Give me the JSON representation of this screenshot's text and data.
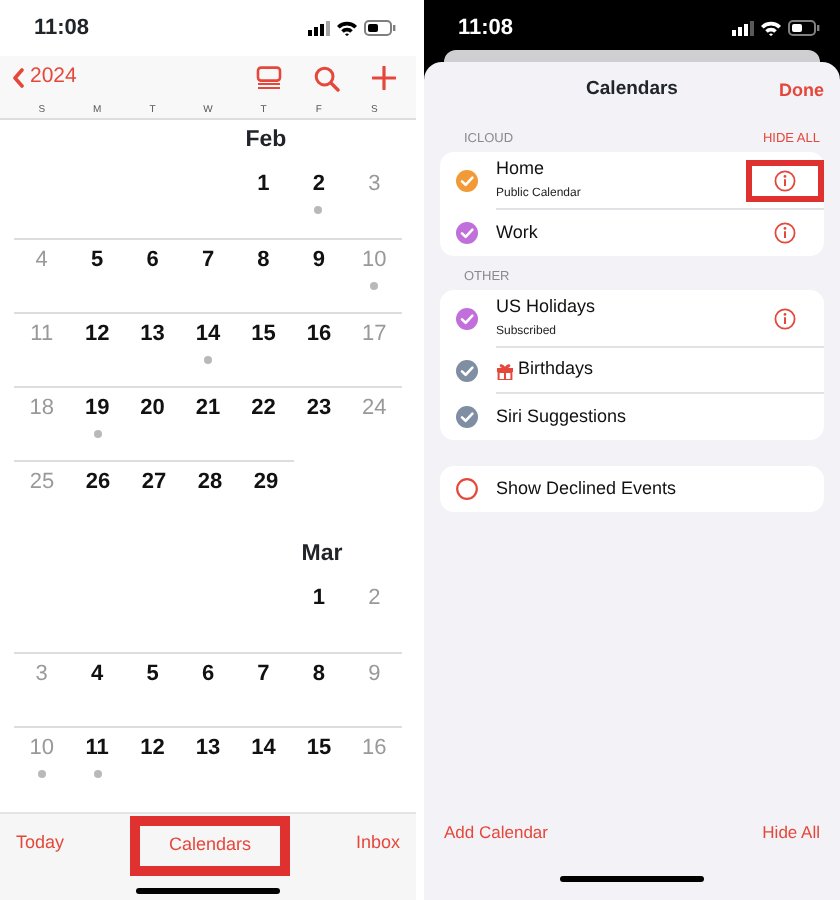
{
  "calendar_view": {
    "status_bar": {
      "time": "11:08"
    },
    "nav_bar": {
      "back_label": "2024"
    },
    "weekdays": [
      "S",
      "M",
      "T",
      "W",
      "T",
      "F",
      "S"
    ],
    "months": [
      {
        "name": "Feb",
        "weeks": [
          {
            "kind": "leading",
            "days": [
              {
                "day": "1",
                "dimmed": false,
                "event": false
              },
              {
                "day": "2",
                "dimmed": false,
                "event": true
              },
              {
                "day": "3",
                "dimmed": true,
                "event": false
              }
            ]
          },
          {
            "kind": "full",
            "days": [
              {
                "day": "4",
                "dimmed": true,
                "event": false
              },
              {
                "day": "5",
                "dimmed": false,
                "event": false
              },
              {
                "day": "6",
                "dimmed": false,
                "event": false
              },
              {
                "day": "7",
                "dimmed": false,
                "event": false
              },
              {
                "day": "8",
                "dimmed": false,
                "event": false
              },
              {
                "day": "9",
                "dimmed": false,
                "event": false
              },
              {
                "day": "10",
                "dimmed": true,
                "event": true
              }
            ]
          },
          {
            "kind": "full",
            "days": [
              {
                "day": "11",
                "dimmed": true,
                "event": false
              },
              {
                "day": "12",
                "dimmed": false,
                "event": false
              },
              {
                "day": "13",
                "dimmed": false,
                "event": false
              },
              {
                "day": "14",
                "dimmed": false,
                "event": true
              },
              {
                "day": "15",
                "dimmed": false,
                "event": false
              },
              {
                "day": "16",
                "dimmed": false,
                "event": false
              },
              {
                "day": "17",
                "dimmed": true,
                "event": false
              }
            ]
          },
          {
            "kind": "full",
            "days": [
              {
                "day": "18",
                "dimmed": true,
                "event": false
              },
              {
                "day": "19",
                "dimmed": false,
                "event": true
              },
              {
                "day": "20",
                "dimmed": false,
                "event": false
              },
              {
                "day": "21",
                "dimmed": false,
                "event": false
              },
              {
                "day": "22",
                "dimmed": false,
                "event": false
              },
              {
                "day": "23",
                "dimmed": false,
                "event": false
              },
              {
                "day": "24",
                "dimmed": true,
                "event": false
              }
            ]
          },
          {
            "kind": "trailing",
            "days": [
              {
                "day": "25",
                "dimmed": true,
                "event": false
              },
              {
                "day": "26",
                "dimmed": false,
                "event": false
              },
              {
                "day": "27",
                "dimmed": false,
                "event": false
              },
              {
                "day": "28",
                "dimmed": false,
                "event": false
              },
              {
                "day": "29",
                "dimmed": false,
                "event": false
              }
            ]
          }
        ]
      },
      {
        "name": "Mar",
        "weeks": [
          {
            "kind": "leading",
            "days": [
              {
                "day": "1",
                "dimmed": false,
                "event": false
              },
              {
                "day": "2",
                "dimmed": true,
                "event": false
              }
            ]
          },
          {
            "kind": "full",
            "days": [
              {
                "day": "3",
                "dimmed": true,
                "event": false
              },
              {
                "day": "4",
                "dimmed": false,
                "event": false
              },
              {
                "day": "5",
                "dimmed": false,
                "event": false
              },
              {
                "day": "6",
                "dimmed": false,
                "event": false
              },
              {
                "day": "7",
                "dimmed": false,
                "event": false
              },
              {
                "day": "8",
                "dimmed": false,
                "event": false
              },
              {
                "day": "9",
                "dimmed": true,
                "event": false
              }
            ]
          },
          {
            "kind": "full",
            "days": [
              {
                "day": "10",
                "dimmed": true,
                "event": true
              },
              {
                "day": "11",
                "dimmed": false,
                "event": true
              },
              {
                "day": "12",
                "dimmed": false,
                "event": false
              },
              {
                "day": "13",
                "dimmed": false,
                "event": false
              },
              {
                "day": "14",
                "dimmed": false,
                "event": false
              },
              {
                "day": "15",
                "dimmed": false,
                "event": false
              },
              {
                "day": "16",
                "dimmed": true,
                "event": false
              }
            ]
          }
        ]
      }
    ],
    "toolbar": [
      {
        "label": "Today",
        "highlighted": false
      },
      {
        "label": "Calendars",
        "highlighted": true
      },
      {
        "label": "Inbox",
        "highlighted": false
      }
    ]
  },
  "calendars_sheet": {
    "status_bar": {
      "time": "11:08"
    },
    "title": "Calendars",
    "done": "Done",
    "sections": [
      {
        "label": "ICLOUD",
        "action": "HIDE ALL",
        "calendars": [
          {
            "name": "Home",
            "subtitle": "Public Calendar",
            "checked": true,
            "color": "#f19a37",
            "gift": false,
            "info": true,
            "highlighted": true
          },
          {
            "name": "Work",
            "checked": true,
            "color": "#c16fdb",
            "gift": false,
            "info": true,
            "highlighted": false
          }
        ]
      },
      {
        "label": "OTHER",
        "calendars": [
          {
            "name": "US Holidays",
            "subtitle": "Subscribed",
            "checked": true,
            "color": "#c16fdb",
            "gift": false,
            "info": true,
            "highlighted": false
          },
          {
            "name": "Birthdays",
            "checked": true,
            "color": "#7f8ea3",
            "gift": true,
            "info": false
          },
          {
            "name": "Siri Suggestions",
            "checked": true,
            "color": "#7f8ea3",
            "gift": false,
            "info": false
          }
        ]
      },
      {
        "calendars": [
          {
            "name": "Show Declined Events",
            "checked": false,
            "color": "#e5483b",
            "gift": false,
            "info": false
          }
        ]
      }
    ],
    "toolbar": {
      "add": "Add Calendar",
      "hide_all": "Hide All"
    }
  }
}
